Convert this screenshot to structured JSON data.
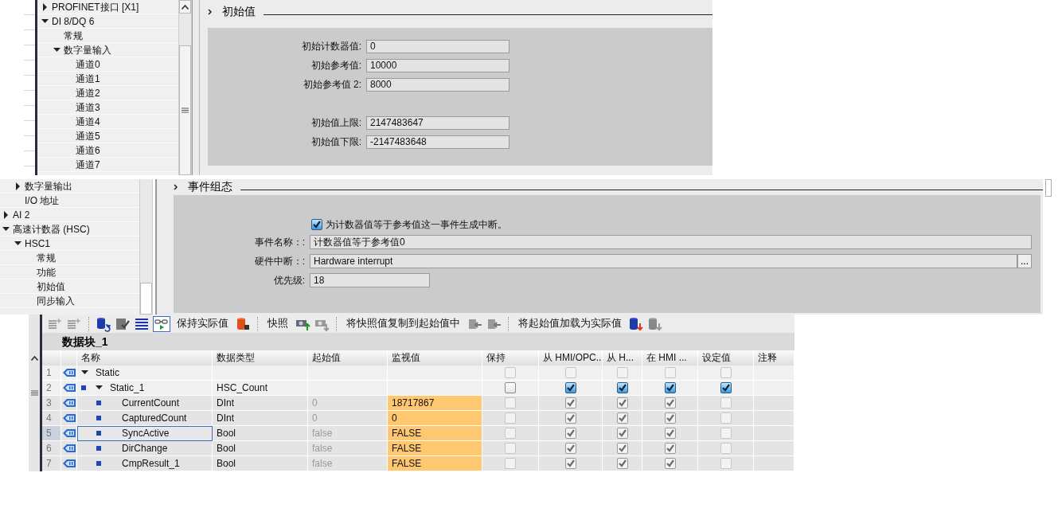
{
  "device_tree_top": {
    "items": [
      {
        "label": "PROFINET接口 [X1]",
        "expanded": false
      },
      {
        "label": "DI 8/DQ 6",
        "expanded": true,
        "children": [
          {
            "label": "常规"
          },
          {
            "label": "数字量输入",
            "expanded": true,
            "children": [
              {
                "label": "通道0"
              },
              {
                "label": "通道1"
              },
              {
                "label": "通道2"
              },
              {
                "label": "通道3"
              },
              {
                "label": "通道4"
              },
              {
                "label": "通道5"
              },
              {
                "label": "通道6"
              },
              {
                "label": "通道7"
              }
            ]
          }
        ]
      }
    ]
  },
  "initial_values": {
    "title": "初始值",
    "field_groups": [
      [
        {
          "label": "初始计数器值:",
          "value": "0"
        },
        {
          "label": "初始参考值:",
          "value": "10000"
        },
        {
          "label": "初始参考值 2:",
          "value": "8000"
        }
      ],
      [
        {
          "label": "初始值上限:",
          "value": "2147483647"
        },
        {
          "label": "初始值下限:",
          "value": "-2147483648"
        }
      ]
    ]
  },
  "device_tree_bottom": {
    "items": [
      {
        "children": [
          {
            "label": "数字量输出",
            "expanded": false
          },
          {
            "label": "I/O 地址"
          }
        ]
      },
      {
        "label": "AI 2",
        "expanded": false
      },
      {
        "label": "高速计数器 (HSC)",
        "expanded": true,
        "children": [
          {
            "label": "HSC1",
            "expanded": true,
            "children": [
              {
                "label": "常规"
              },
              {
                "label": "功能"
              },
              {
                "label": "初始值"
              },
              {
                "label": "同步输入"
              }
            ]
          }
        ]
      }
    ]
  },
  "event_config": {
    "title": "事件组态",
    "interrupt": {
      "label": "为计数器值等于参考值这一事件生成中断。",
      "checked": true
    },
    "fields": [
      {
        "kind": "text",
        "label": "事件名称：:",
        "value": "计数器值等于参考值0"
      },
      {
        "kind": "browse",
        "label": "硬件中断：:",
        "value": "Hardware interrupt",
        "button": "..."
      },
      {
        "kind": "short",
        "label": "优先级:",
        "value": "18"
      }
    ]
  },
  "data_block": {
    "toolbar": {
      "monitor_on": true,
      "buttons": [
        "保持实际值",
        "快照",
        "将快照值复制到起始值中",
        "将起始值加载为实际值"
      ]
    },
    "title": "数据块_1",
    "columns": [
      "名称",
      "数据类型",
      "起始值",
      "监视值",
      "保持",
      "从 HMI/OPC..",
      "从 H...",
      "在 HMI ...",
      "设定值",
      "注释"
    ],
    "rows": [
      {
        "number": "1",
        "name": "Static",
        "expanded": true,
        "selected": false,
        "flags": [
          {
            "checked": false,
            "disabled": true
          },
          {
            "checked": false,
            "disabled": true
          },
          {
            "checked": false,
            "disabled": true
          },
          {
            "checked": false,
            "disabled": true
          },
          {
            "checked": false,
            "disabled": true
          }
        ],
        "children": [
          {
            "number": "2",
            "name": "Static_1",
            "type": "HSC_Count",
            "expanded": true,
            "selected": false,
            "flags": [
              {
                "checked": false,
                "disabled": false
              },
              {
                "checked": true,
                "disabled": false
              },
              {
                "checked": true,
                "disabled": false
              },
              {
                "checked": true,
                "disabled": false
              },
              {
                "checked": true,
                "disabled": false
              }
            ],
            "children": [
              {
                "number": "3",
                "name": "CurrentCount",
                "type": "DInt",
                "start": "0",
                "monitor": "18717867",
                "selected": false,
                "flags": [
                  {
                    "checked": false,
                    "disabled": true
                  },
                  {
                    "checked": true,
                    "disabled": true
                  },
                  {
                    "checked": true,
                    "disabled": true
                  },
                  {
                    "checked": true,
                    "disabled": true
                  },
                  {
                    "checked": false,
                    "disabled": true
                  }
                ]
              },
              {
                "number": "4",
                "name": "CapturedCount",
                "type": "DInt",
                "start": "0",
                "monitor": "0",
                "selected": false,
                "flags": [
                  {
                    "checked": false,
                    "disabled": true
                  },
                  {
                    "checked": true,
                    "disabled": true
                  },
                  {
                    "checked": true,
                    "disabled": true
                  },
                  {
                    "checked": true,
                    "disabled": true
                  },
                  {
                    "checked": false,
                    "disabled": true
                  }
                ]
              },
              {
                "number": "5",
                "name": "SyncActive",
                "type": "Bool",
                "start": "false",
                "monitor": "FALSE",
                "selected": true,
                "flags": [
                  {
                    "checked": false,
                    "disabled": true
                  },
                  {
                    "checked": true,
                    "disabled": true
                  },
                  {
                    "checked": true,
                    "disabled": true
                  },
                  {
                    "checked": true,
                    "disabled": true
                  },
                  {
                    "checked": false,
                    "disabled": true
                  }
                ]
              },
              {
                "number": "6",
                "name": "DirChange",
                "type": "Bool",
                "start": "false",
                "monitor": "FALSE",
                "selected": false,
                "flags": [
                  {
                    "checked": false,
                    "disabled": true
                  },
                  {
                    "checked": true,
                    "disabled": true
                  },
                  {
                    "checked": true,
                    "disabled": true
                  },
                  {
                    "checked": true,
                    "disabled": true
                  },
                  {
                    "checked": false,
                    "disabled": true
                  }
                ]
              },
              {
                "number": "7",
                "name": "CmpResult_1",
                "type": "Bool",
                "start": "false",
                "monitor": "FALSE",
                "selected": false,
                "flags": [
                  {
                    "checked": false,
                    "disabled": true
                  },
                  {
                    "checked": true,
                    "disabled": true
                  },
                  {
                    "checked": true,
                    "disabled": true
                  },
                  {
                    "checked": true,
                    "disabled": true
                  },
                  {
                    "checked": false,
                    "disabled": true
                  }
                ]
              }
            ]
          }
        ]
      }
    ]
  }
}
